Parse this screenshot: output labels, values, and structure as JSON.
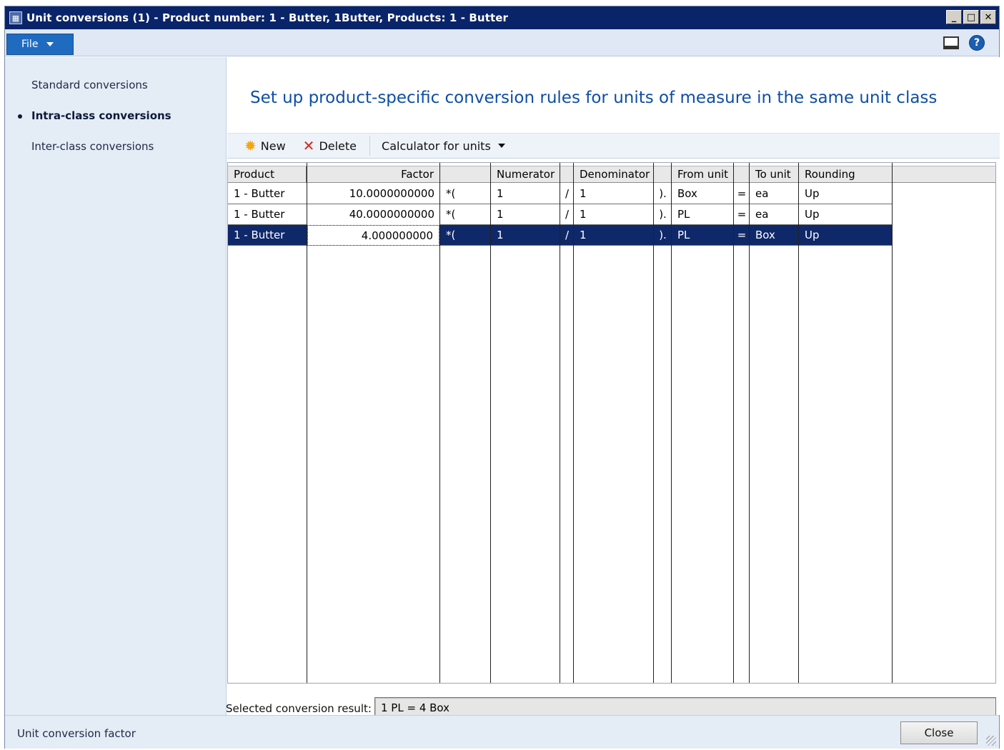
{
  "window": {
    "title": "Unit conversions (1) - Product number: 1 - Butter, 1Butter, Products: 1 - Butter",
    "app_icon": "table-icon",
    "controls": {
      "minimize": "_",
      "maximize": "□",
      "close": "✕"
    }
  },
  "ribbon": {
    "file_label": "File"
  },
  "leftnav": {
    "items": [
      {
        "label": "Standard conversions",
        "active": false
      },
      {
        "label": "Intra-class conversions",
        "active": true
      },
      {
        "label": "Inter-class conversions",
        "active": false
      }
    ]
  },
  "main": {
    "title": "Set up product-specific conversion rules for units of measure in the same unit class"
  },
  "toolbar": {
    "new_label": "New",
    "delete_label": "Delete",
    "calculator_label": "Calculator for units"
  },
  "grid": {
    "columns": [
      "Product",
      "Factor",
      "",
      "Numerator",
      "",
      "Denominator",
      "",
      "From unit",
      "",
      "To unit",
      "Rounding"
    ],
    "rows": [
      {
        "product": "1 - Butter",
        "factor": "10.0000000000",
        "op1": "*(",
        "numerator": "1",
        "op2": "/",
        "denominator": "1",
        "op3": ").",
        "from_unit": "Box",
        "op4": "=",
        "to_unit": "ea",
        "rounding": "Up"
      },
      {
        "product": "1 - Butter",
        "factor": "40.0000000000",
        "op1": "*(",
        "numerator": "1",
        "op2": "/",
        "denominator": "1",
        "op3": ").",
        "from_unit": "PL",
        "op4": "=",
        "to_unit": "ea",
        "rounding": "Up"
      },
      {
        "product": "1 - Butter",
        "factor": "4.000000000",
        "op1": "*(",
        "numerator": "1",
        "op2": "/",
        "denominator": "1",
        "op3": ").",
        "from_unit": "PL",
        "op4": "=",
        "to_unit": "Box",
        "rounding": "Up"
      }
    ],
    "selected_row": 2
  },
  "result": {
    "label": "Selected conversion result:",
    "value": "1 PL = 4 Box"
  },
  "statusbar": {
    "text": "Unit conversion factor",
    "close_label": "Close"
  },
  "colors": {
    "titlebar": "#0a246a",
    "file_button": "#1f6bc0",
    "heading": "#0e4ea6",
    "selected_row": "#0f2869"
  }
}
